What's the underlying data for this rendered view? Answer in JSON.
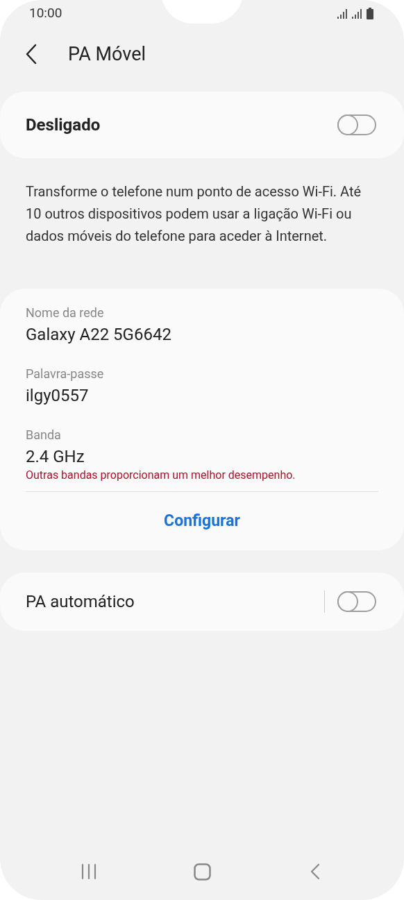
{
  "status_bar": {
    "time": "10:00"
  },
  "header": {
    "title": "PA Móvel"
  },
  "master_switch": {
    "label": "Desligado",
    "on": false
  },
  "description": "Transforme o telefone num ponto de acesso Wi-Fi. Até 10 outros dispositivos podem usar a ligação Wi-Fi ou dados móveis do telefone para aceder à Internet.",
  "settings": [
    {
      "label": "Nome da rede",
      "value": "Galaxy A22 5G6642"
    },
    {
      "label": "Palavra-passe",
      "value": "ilgy0557"
    },
    {
      "label": "Banda",
      "value": "2.4 GHz",
      "warning": "Outras bandas proporcionam um melhor desempenho."
    }
  ],
  "configure_button": "Configurar",
  "auto_switch": {
    "label": "PA automático",
    "on": false
  }
}
